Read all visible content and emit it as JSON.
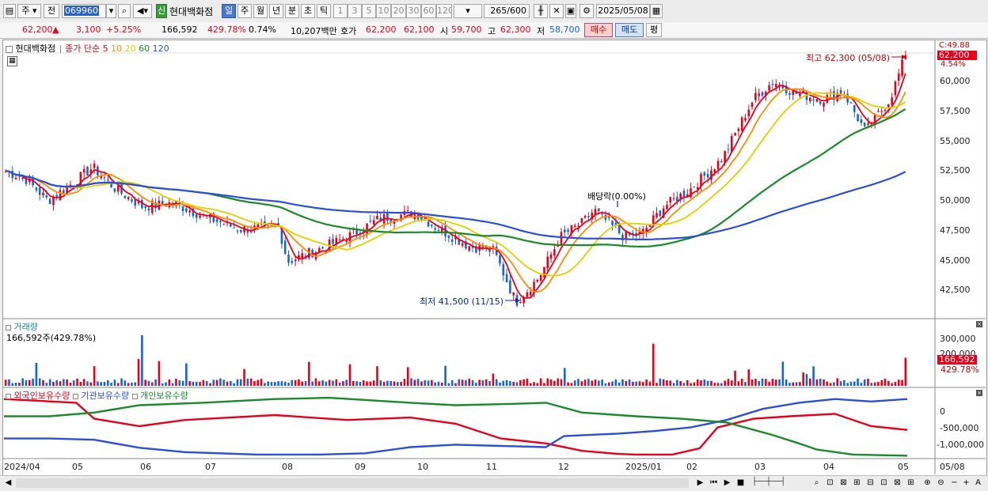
{
  "toolbar": {
    "period_label": "주",
    "prev_label": "전",
    "code_value": "069960",
    "badge": "신",
    "stock_name": "현대백화점",
    "periods": [
      "일",
      "주",
      "월",
      "년",
      "분",
      "초",
      "틱"
    ],
    "active_period": "일",
    "intervals": [
      "1",
      "3",
      "5",
      "10",
      "20",
      "30",
      "60",
      "120"
    ],
    "count_value": "265",
    "count_total": "/600",
    "date_value": "2025/05/08"
  },
  "infobar": {
    "price": "62,200",
    "up_arrow": "▲",
    "change": "3,100",
    "change_pct": "+5.25%",
    "volume": "166,592",
    "vol_ratio": "429.78%",
    "turnover": "0.74%",
    "amount": "10,207백만",
    "quote_label": "호가",
    "ask": "62,200",
    "bid": "62,100",
    "open_label": "시",
    "open": "59,700",
    "high_label": "고",
    "high": "62,300",
    "low_label": "저",
    "low": "58,700",
    "buy_label": "매수",
    "sell_label": "매도",
    "eval_label": "평"
  },
  "legend": {
    "name": "현대백화점",
    "ma_label": "종가 단순",
    "ma_periods": [
      {
        "label": "5",
        "color": "#e8001a"
      },
      {
        "label": "10",
        "color": "#ff8c00"
      },
      {
        "label": "20",
        "color": "#e0d000"
      },
      {
        "label": "60",
        "color": "#1a8a2a"
      },
      {
        "label": "120",
        "color": "#2b4fd6"
      }
    ]
  },
  "annotations": {
    "high_note": "최고 62,300 (05/08)",
    "low_note": "최저 41,500 (11/15)",
    "dividend_note": "배당락(0.00%)",
    "current_price_box": "62,200",
    "current_top_label": "C:49.88",
    "current_pct_label": "4.54%"
  },
  "price_axis": [
    "60,000",
    "57,500",
    "55,000",
    "52,500",
    "50,000",
    "47,500",
    "45,000",
    "42,500"
  ],
  "volume_panel": {
    "title": "거래량",
    "value_label": "166,592주(429.78%)",
    "axis": [
      "300,000",
      "200,000"
    ],
    "current_box": "166,592",
    "current_pct": "429.78%"
  },
  "flow_panel": {
    "titles": [
      {
        "label": "외국인보유수량",
        "color": "#e8001a"
      },
      {
        "label": "기관보유수량",
        "color": "#2b4fd6"
      },
      {
        "label": "개인보유수량",
        "color": "#1a8a2a"
      }
    ],
    "axis": [
      "0",
      "-500,000",
      "-1,000,000"
    ]
  },
  "x_axis": [
    "2024/04",
    "05",
    "06",
    "07",
    "08",
    "09",
    "10",
    "11",
    "12",
    "2025/01",
    "02",
    "03",
    "04",
    "05",
    "05/08"
  ],
  "colors": {
    "up": "#e8001a",
    "down": "#1565d8",
    "ma5": "#e8001a",
    "ma10": "#ff8c00",
    "ma20": "#e0d000",
    "ma60": "#1a8a2a",
    "ma120": "#2b4fd6"
  },
  "chart_data": {
    "type": "candlestick",
    "title": "현대백화점",
    "ylim": [
      41000,
      63500
    ],
    "price_points": [
      [
        "2024/04/01",
        52500
      ],
      [
        "2024/04/10",
        51800
      ],
      [
        "2024/04/20",
        50000
      ],
      [
        "2024/05/01",
        51500
      ],
      [
        "2024/05/10",
        52800
      ],
      [
        "2024/05/20",
        51000
      ],
      [
        "2024/06/01",
        49500
      ],
      [
        "2024/06/15",
        49800
      ],
      [
        "2024/07/01",
        48500
      ],
      [
        "2024/07/15",
        47600
      ],
      [
        "2024/08/01",
        47800
      ],
      [
        "2024/08/05",
        44900
      ],
      [
        "2024/08/20",
        46000
      ],
      [
        "2024/09/01",
        47000
      ],
      [
        "2024/09/15",
        48500
      ],
      [
        "2024/10/01",
        49000
      ],
      [
        "2024/10/10",
        47800
      ],
      [
        "2024/10/25",
        46200
      ],
      [
        "2024/11/05",
        45800
      ],
      [
        "2024/11/15",
        41500
      ],
      [
        "2024/11/25",
        43500
      ],
      [
        "2024/12/05",
        47000
      ],
      [
        "2024/12/15",
        48200
      ],
      [
        "2024/12/20",
        49200
      ],
      [
        "2025/01/02",
        47000
      ],
      [
        "2025/01/10",
        47200
      ],
      [
        "2025/01/20",
        49500
      ],
      [
        "2025/02/01",
        51000
      ],
      [
        "2025/02/15",
        53500
      ],
      [
        "2025/03/01",
        58500
      ],
      [
        "2025/03/10",
        60000
      ],
      [
        "2025/03/20",
        59000
      ],
      [
        "2025/04/01",
        58500
      ],
      [
        "2025/04/10",
        59200
      ],
      [
        "2025/04/20",
        55800
      ],
      [
        "2025/05/01",
        58500
      ],
      [
        "2025/05/08",
        62200
      ]
    ],
    "high": {
      "value": 62300,
      "date": "05/08"
    },
    "low": {
      "value": 41500,
      "date": "11/15"
    },
    "last_volume": 166592
  }
}
